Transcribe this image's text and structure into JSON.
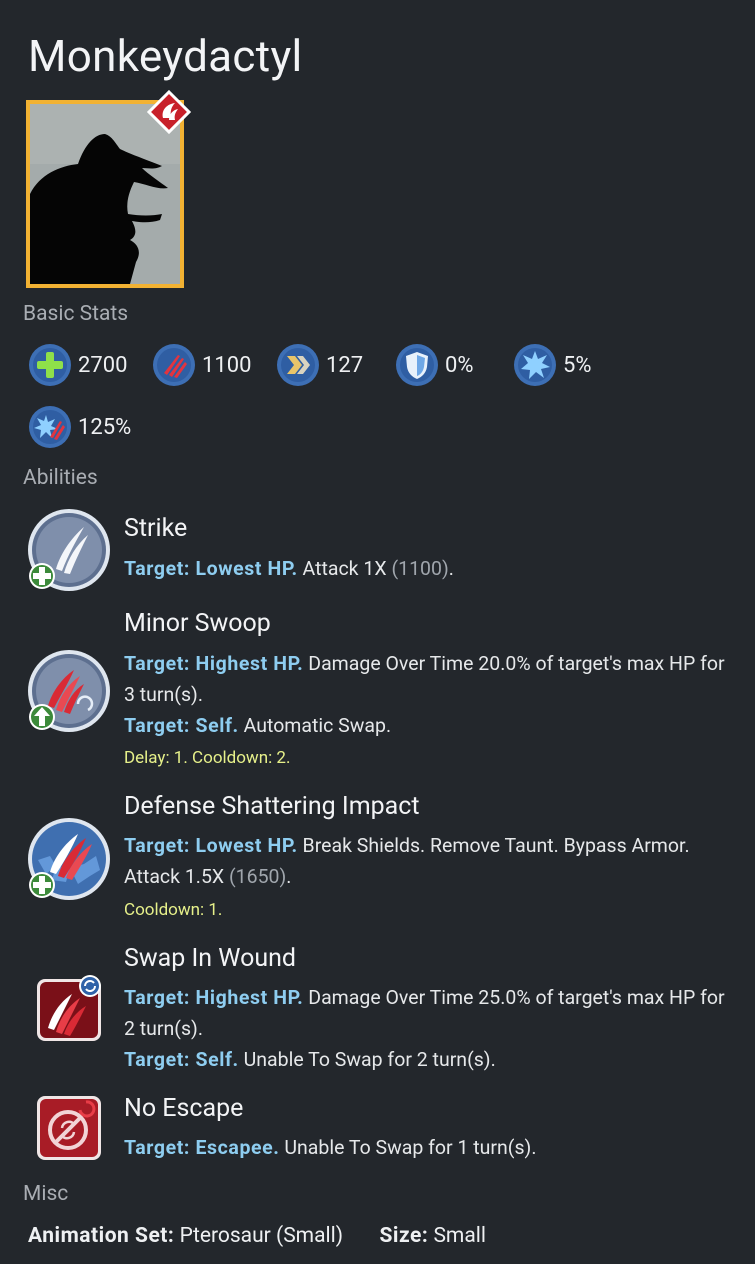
{
  "title": "Monkeydactyl",
  "sections": {
    "basic_stats": "Basic Stats",
    "abilities": "Abilities",
    "misc": "Misc"
  },
  "stats": [
    {
      "icon": "health-icon",
      "value": "2700"
    },
    {
      "icon": "damage-icon",
      "value": "1100"
    },
    {
      "icon": "speed-icon",
      "value": "127"
    },
    {
      "icon": "armor-icon",
      "value": "0%"
    },
    {
      "icon": "crit-chance-icon",
      "value": "5%"
    },
    {
      "icon": "crit-damage-icon",
      "value": "125%"
    }
  ],
  "abilities": [
    {
      "name": "Strike",
      "lines": [
        {
          "target": "Target: Lowest HP.",
          "text": " Attack 1X ",
          "dim": "(1100)",
          "after": "."
        }
      ],
      "note": ""
    },
    {
      "name": "Minor Swoop",
      "lines": [
        {
          "target": "Target: Highest HP.",
          "text": " Damage Over Time 20.0% of target's max HP for 3 turn(s)."
        },
        {
          "target": "Target: Self.",
          "text": " Automatic Swap."
        }
      ],
      "note": "Delay: 1. Cooldown: 2."
    },
    {
      "name": "Defense Shattering Impact",
      "lines": [
        {
          "target": "Target: Lowest HP.",
          "text": " Break Shields. Remove Taunt. Bypass Armor. Attack 1.5X ",
          "dim": "(1650)",
          "after": "."
        }
      ],
      "note": "Cooldown: 1."
    },
    {
      "name": "Swap In Wound",
      "lines": [
        {
          "target": "Target: Highest HP.",
          "text": " Damage Over Time 25.0% of target's max HP for 2 turn(s)."
        },
        {
          "target": "Target: Self.",
          "text": " Unable To Swap for 2 turn(s)."
        }
      ],
      "note": ""
    },
    {
      "name": "No Escape",
      "lines": [
        {
          "target": "Target: Escapee.",
          "text": " Unable To Swap for 1 turn(s)."
        }
      ],
      "note": ""
    }
  ],
  "misc": {
    "animation_label": "Animation Set:",
    "animation_value": "Pterosaur (Small)",
    "size_label": "Size:",
    "size_value": "Small"
  },
  "colors": {
    "background": "#23272c",
    "target_blue": "#8ecdf0",
    "note_yellow": "#e6f08a",
    "portrait_border": "#f2b233"
  }
}
